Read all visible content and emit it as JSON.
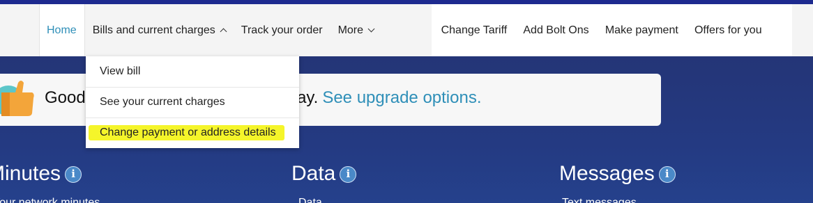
{
  "nav": {
    "home": "Home",
    "bills": "Bills and current charges",
    "track": "Track your order",
    "more": "More",
    "right_items": [
      "Change Tariff",
      "Add Bolt Ons",
      "Make payment",
      "Offers for you"
    ]
  },
  "dropdown": {
    "items": [
      "View bill",
      "See your current charges",
      "Change payment or address details"
    ]
  },
  "banner": {
    "text_start": "Good",
    "text_end": "today.",
    "link": "See upgrade options."
  },
  "sections": {
    "minutes": {
      "title": "Minutes",
      "sub": "Your network minutes"
    },
    "data": {
      "title": "Data",
      "sub": "Data"
    },
    "messages": {
      "title": "Messages",
      "sub": "Text messages"
    },
    "info_glyph": "i"
  },
  "colors": {
    "accent": "#2f8fb8",
    "background": "#243779",
    "highlight": "#f5f52a"
  }
}
